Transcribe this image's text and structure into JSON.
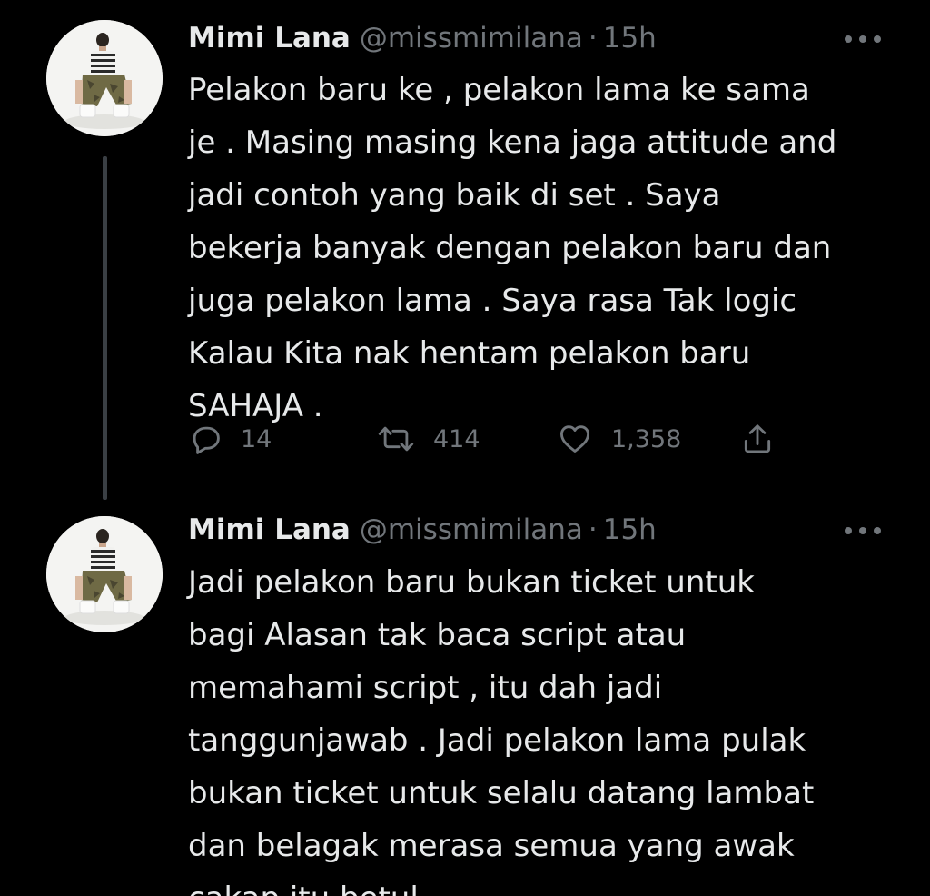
{
  "tweets": [
    {
      "author": {
        "name": "Mimi Lana",
        "handle": "@missmimilana",
        "separator": "·",
        "time": "15h"
      },
      "lines": [
        "Pelakon baru ke , pelakon lama ke sama",
        "je . Masing masing kena jaga attitude and",
        "jadi contoh yang baik di set . Saya",
        "bekerja banyak dengan pelakon baru dan",
        "juga pelakon lama . Saya rasa Tak logic",
        "Kalau Kita nak hentam pelakon baru",
        "SAHAJA ."
      ],
      "stats": {
        "replies": "14",
        "retweets": "414",
        "likes": "1,358"
      }
    },
    {
      "author": {
        "name": "Mimi Lana",
        "handle": "@missmimilana",
        "separator": "·",
        "time": "15h"
      },
      "lines": [
        "Jadi pelakon baru bukan ticket untuk",
        "bagi Alasan tak baca script atau",
        "memahami script , itu dah jadi",
        "tanggunjawab . Jadi pelakon lama pulak",
        "bukan ticket untuk selalu datang lambat",
        "dan belagak merasa semua yang awak",
        "cakap itu betul ."
      ]
    }
  ],
  "icons": {
    "reply": "reply-icon",
    "retweet": "retweet-icon",
    "like": "heart-icon",
    "share": "share-icon",
    "more": "more-icon"
  },
  "colors": {
    "background": "#000000",
    "text": "#e7e9ea",
    "secondary": "#71767b",
    "thread_line": "#3a3f44"
  }
}
